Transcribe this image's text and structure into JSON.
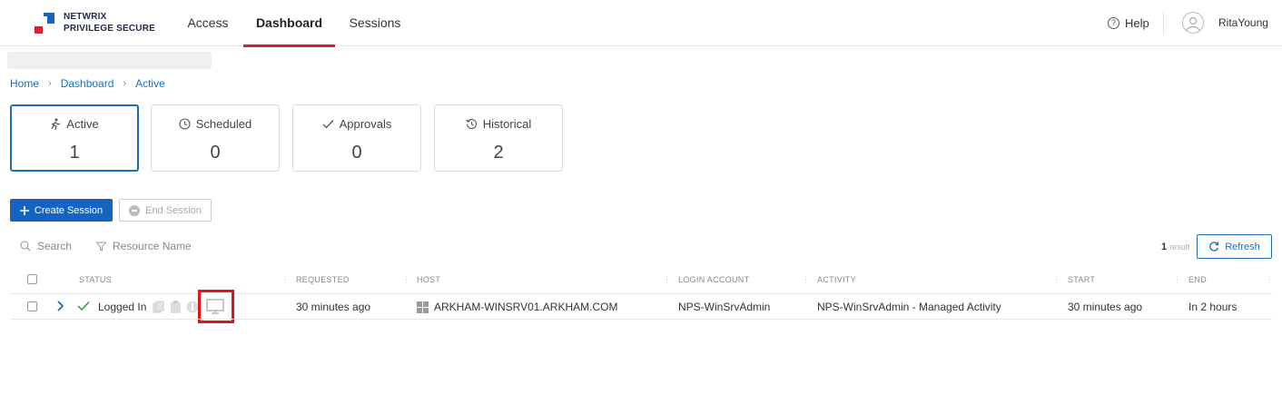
{
  "brand": {
    "line1": "NETWRIX",
    "line2": "PRIVILEGE SECURE"
  },
  "nav": {
    "tabs": [
      {
        "label": "Access",
        "active": false
      },
      {
        "label": "Dashboard",
        "active": true
      },
      {
        "label": "Sessions",
        "active": false
      }
    ],
    "help_label": "Help",
    "username": "RitaYoung"
  },
  "breadcrumb": [
    "Home",
    "Dashboard",
    "Active"
  ],
  "cards": [
    {
      "label": "Active",
      "value": "1",
      "icon": "running-person-icon",
      "active": true
    },
    {
      "label": "Scheduled",
      "value": "0",
      "icon": "clock-icon",
      "active": false
    },
    {
      "label": "Approvals",
      "value": "0",
      "icon": "checkmark-icon",
      "active": false
    },
    {
      "label": "Historical",
      "value": "2",
      "icon": "history-icon",
      "active": false
    }
  ],
  "actions": {
    "create_label": "Create Session",
    "end_label": "End Session"
  },
  "filters": {
    "search_label": "Search",
    "resource_label": "Resource Name"
  },
  "results": {
    "count": "1",
    "label": "result"
  },
  "refresh_label": "Refresh",
  "table": {
    "headers": {
      "status": "STATUS",
      "requested": "REQUESTED",
      "host": "HOST",
      "login_account": "LOGIN ACCOUNT",
      "activity": "ACTIVITY",
      "start": "START",
      "end": "END"
    },
    "rows": [
      {
        "status": "Logged In",
        "requested": "30 minutes ago",
        "host": "ARKHAM-WINSRV01.ARKHAM.COM",
        "login_account": "NPS-WinSrvAdmin",
        "activity": "NPS-WinSrvAdmin - Managed Activity",
        "start": "30 minutes ago",
        "end": "In 2 hours"
      }
    ]
  },
  "colors": {
    "accent_red": "#d6222a",
    "primary_blue": "#1565c0",
    "link_blue": "#1a6ebd",
    "success_green": "#2e9e3e",
    "highlight_red": "#e0141b"
  }
}
